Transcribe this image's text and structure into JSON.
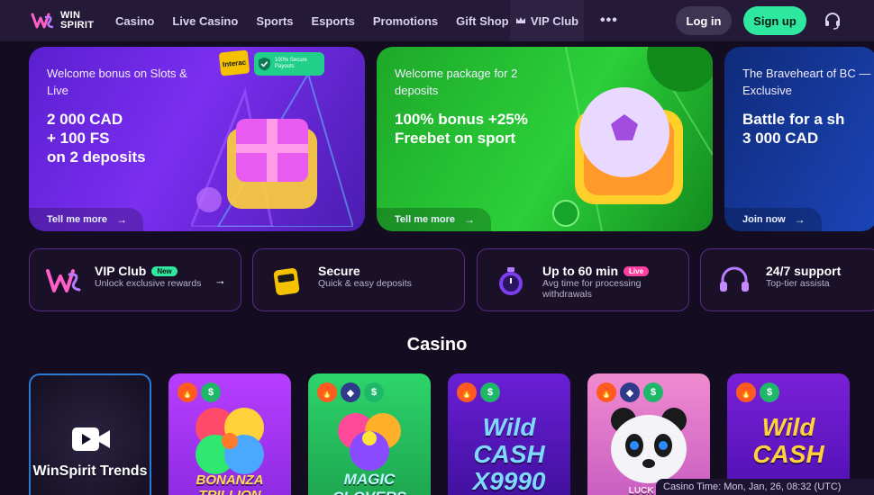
{
  "header": {
    "brand_line1": "WIN",
    "brand_line2": "SPIRIT",
    "nav": [
      "Casino",
      "Live Casino",
      "Sports",
      "Esports",
      "Promotions",
      "Gift Shop"
    ],
    "vip": "VIP Club",
    "more": "•••",
    "login": "Log in",
    "signup": "Sign up"
  },
  "promos": [
    {
      "sub": "Welcome bonus on Slots & Live",
      "main_lines": [
        "2 000 CAD",
        "+ 100 FS",
        "on 2 deposits"
      ],
      "cta": "Tell me more",
      "badge_interac": "Interac",
      "badge_secure": "100% Secure Payouts"
    },
    {
      "sub": "Welcome package for 2 deposits",
      "main_lines": [
        "100% bonus +25%",
        "Freebet on sport"
      ],
      "cta": "Tell me more"
    },
    {
      "sub": "The Braveheart of BC — Exclusive",
      "main_lines": [
        "Battle for a sh",
        "3 000 CAD"
      ],
      "cta": "Join now"
    }
  ],
  "features": [
    {
      "title": "VIP Club",
      "pill": "New",
      "desc": "Unlock exclusive rewards"
    },
    {
      "title": "Secure",
      "desc": "Quick & easy deposits"
    },
    {
      "title": "Up to 60 min",
      "pill": "Live",
      "desc": "Avg time for processing withdrawals"
    },
    {
      "title": "24/7 support",
      "desc": "Top-tier assista"
    }
  ],
  "section_title": "Casino",
  "games": [
    {
      "title": "WinSpirit Trends"
    },
    {
      "title": "BONANZA TRILLION"
    },
    {
      "title": "MAGIC CLOVERS"
    },
    {
      "title": "Wild CASH X9990"
    },
    {
      "title": "LUCK OF"
    },
    {
      "title": "Wild CASH"
    }
  ],
  "casino_time": "Casino Time: Mon, Jan, 26, 08:32 (UTC)",
  "colors": {
    "accent_green": "#2ee8a0",
    "header_bg": "#241a38",
    "page_bg": "#140d22"
  }
}
